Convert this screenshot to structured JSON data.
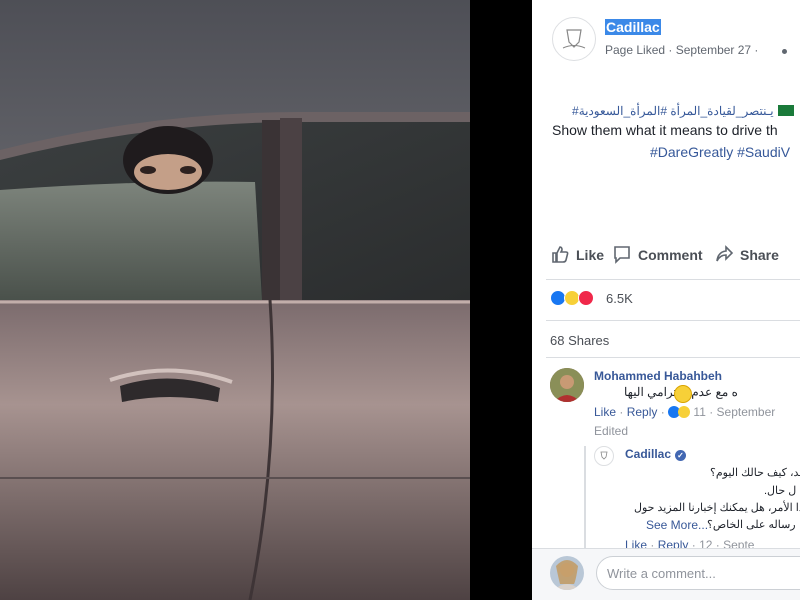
{
  "post": {
    "page_name": "Cadillac",
    "meta": "Page Liked · September 27 ·",
    "hashtag_line_ar": "#يـنتصر_لقيادة_المرأة #المرأة_السعودية",
    "text_en": "Show them what it means to drive th",
    "hashtags_en": "#DareGreatly #SaudiV"
  },
  "actions": {
    "like": "Like",
    "comment": "Comment",
    "share": "Share"
  },
  "reactions": {
    "count": "6.5K",
    "icons": [
      "like-icon",
      "haha-icon",
      "love-icon"
    ]
  },
  "shares": "68 Shares",
  "comments": [
    {
      "author": "Mohammed Habahbeh",
      "text": "ه مع عدم احترامي اليها",
      "like": "Like",
      "reply": "Reply",
      "dot": "·",
      "time": "11 · September",
      "edited": "Edited",
      "replies": [
        {
          "author": "Cadillac",
          "lines": [
            "مد، كيف حالك اليوم؟",
            "ل حال.",
            "ذا الأمر، هل يمكنك إخبارنا المزيد حول",
            "رساله على الخاص؟"
          ],
          "see_more": "See More...",
          "like": "Like",
          "reply": "Reply",
          "dot": "·",
          "time": "12 · Septe"
        }
      ]
    }
  ],
  "composer": {
    "placeholder": "Write a comment..."
  },
  "colors": {
    "facebook_blue": "#365899",
    "text": "#1d2129",
    "muted": "#90949c",
    "background_dark": "#000000"
  }
}
